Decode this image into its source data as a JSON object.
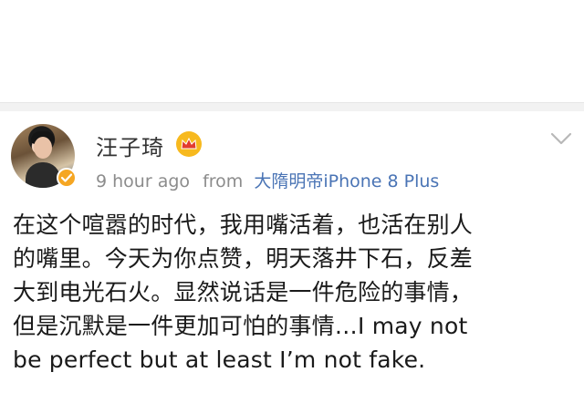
{
  "post": {
    "username": "汪子琦",
    "time": "9 hour ago",
    "from_label": "from",
    "source": "大隋明帝iPhone 8 Plus",
    "text_lines": [
      "在这个喧嚣的时代，我用嘴活着，也活在别人",
      "的嘴里。今天为你点赞，明天落井下石，反差",
      "大到电光石火。显然说话是一件危险的事情，",
      "但是沉默是一件更加可怕的事情…I may not",
      "be perfect but at least I’m not fake."
    ]
  },
  "colors": {
    "username": "#333333",
    "meta": "#8c8c8c",
    "source_link": "#4a74b5",
    "body_text": "#1a1a1a",
    "badge": "#f5a623"
  },
  "icons": {
    "crown": "crown-icon",
    "verified": "verified-badge-icon",
    "dropdown": "chevron-down-icon"
  }
}
